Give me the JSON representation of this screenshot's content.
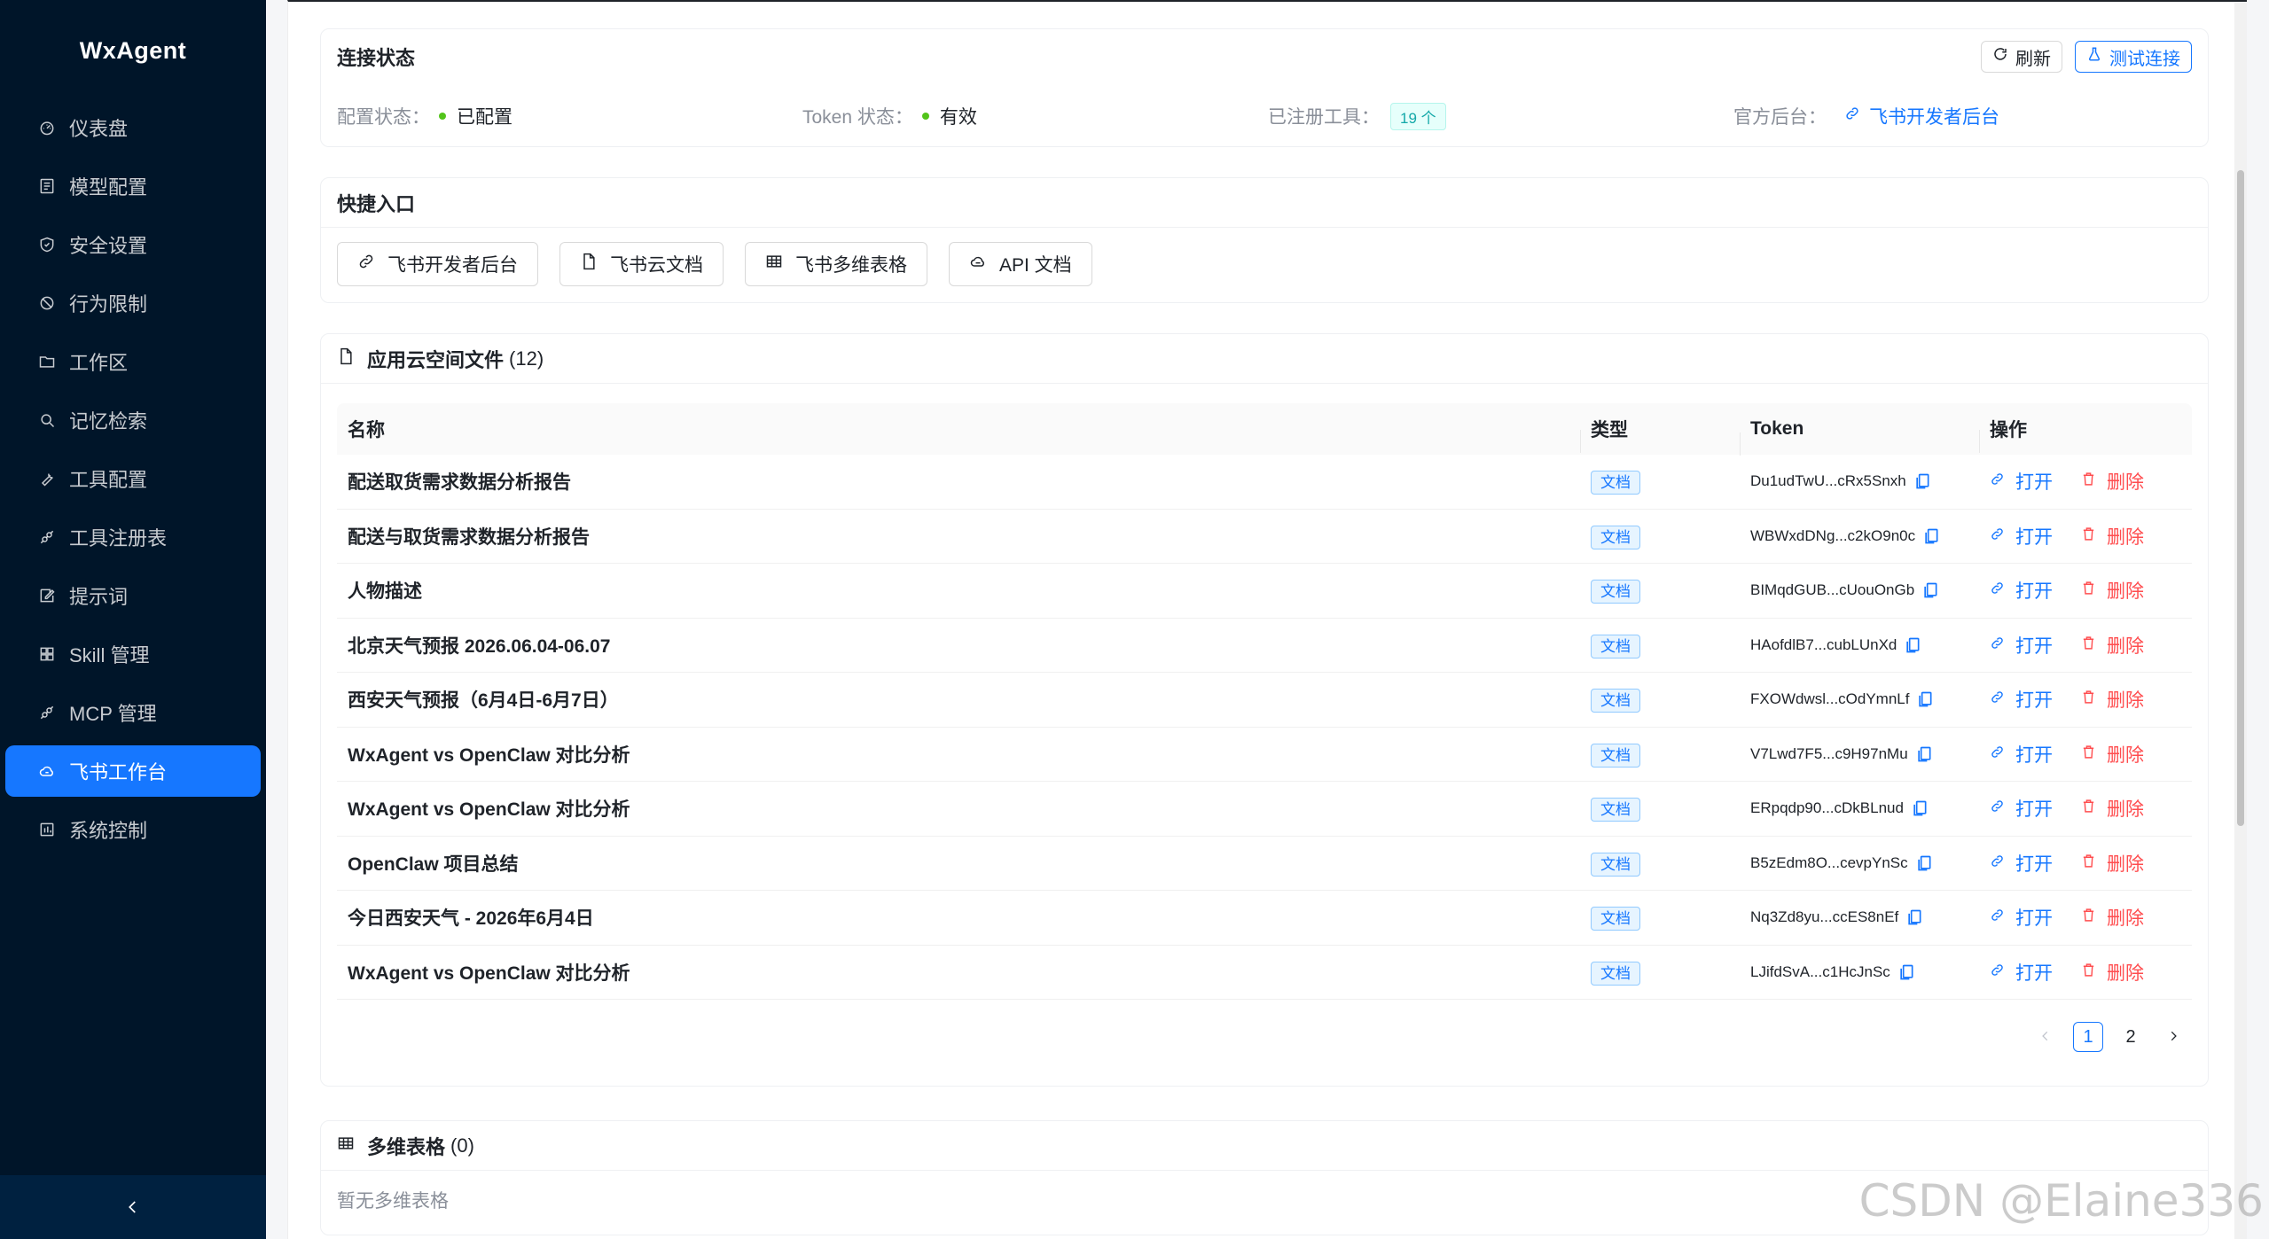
{
  "app": {
    "title": "WxAgent"
  },
  "sidebar": {
    "items": [
      {
        "label": "仪表盘",
        "icon": "dashboard-icon"
      },
      {
        "label": "模型配置",
        "icon": "model-icon"
      },
      {
        "label": "安全设置",
        "icon": "shield-icon"
      },
      {
        "label": "行为限制",
        "icon": "ban-icon"
      },
      {
        "label": "工作区",
        "icon": "folder-icon"
      },
      {
        "label": "记忆检索",
        "icon": "search-icon"
      },
      {
        "label": "工具配置",
        "icon": "wrench-icon"
      },
      {
        "label": "工具注册表",
        "icon": "api-icon"
      },
      {
        "label": "提示词",
        "icon": "edit-icon"
      },
      {
        "label": "Skill 管理",
        "icon": "grid-icon"
      },
      {
        "label": "MCP 管理",
        "icon": "api-icon"
      },
      {
        "label": "飞书工作台",
        "icon": "cloud-icon",
        "active": true
      },
      {
        "label": "系统控制",
        "icon": "control-icon"
      }
    ]
  },
  "connection": {
    "title": "连接状态",
    "refresh_label": "刷新",
    "test_label": "测试连接",
    "config_label": "配置状态：",
    "config_value": "已配置",
    "token_label": "Token 状态：",
    "token_value": "有效",
    "tools_label": "已注册工具：",
    "tools_value": "19 个",
    "console_label": "官方后台：",
    "console_link": "飞书开发者后台"
  },
  "quick": {
    "title": "快捷入口",
    "buttons": [
      {
        "label": "飞书开发者后台",
        "icon": "link-icon"
      },
      {
        "label": "飞书云文档",
        "icon": "file-icon"
      },
      {
        "label": "飞书多维表格",
        "icon": "table-icon"
      },
      {
        "label": "API 文档",
        "icon": "api-cloud-icon"
      }
    ]
  },
  "files": {
    "title": "应用云空间文件",
    "count": "(12)",
    "columns": {
      "name": "名称",
      "type": "类型",
      "token": "Token",
      "op": "操作"
    },
    "open_label": "打开",
    "delete_label": "删除",
    "rows": [
      {
        "name": "配送取货需求数据分析报告",
        "type": "文档",
        "token": "Du1udTwU...cRx5Snxh"
      },
      {
        "name": "配送与取货需求数据分析报告",
        "type": "文档",
        "token": "WBWxdDNg...c2kO9n0c"
      },
      {
        "name": "人物描述",
        "type": "文档",
        "token": "BIMqdGUB...cUouOnGb"
      },
      {
        "name": "北京天气预报 2026.06.04-06.07",
        "type": "文档",
        "token": "HAofdlB7...cubLUnXd"
      },
      {
        "name": "西安天气预报（6月4日-6月7日）",
        "type": "文档",
        "token": "FXOWdwsl...cOdYmnLf"
      },
      {
        "name": "WxAgent vs OpenClaw 对比分析",
        "type": "文档",
        "token": "V7Lwd7F5...c9H97nMu"
      },
      {
        "name": "WxAgent vs OpenClaw 对比分析",
        "type": "文档",
        "token": "ERpqdp90...cDkBLnud"
      },
      {
        "name": "OpenClaw 项目总结",
        "type": "文档",
        "token": "B5zEdm8O...cevpYnSc"
      },
      {
        "name": "今日西安天气 - 2026年6月4日",
        "type": "文档",
        "token": "Nq3Zd8yu...ccES8nEf"
      },
      {
        "name": "WxAgent vs OpenClaw 对比分析",
        "type": "文档",
        "token": "LJifdSvA...c1HcJnSc"
      }
    ],
    "pagination": {
      "pages": [
        "1",
        "2"
      ],
      "current": "1"
    }
  },
  "bitable": {
    "title": "多维表格",
    "count": "(0)",
    "empty": "暂无多维表格"
  },
  "watermark": "CSDN @Elaine336",
  "colors": {
    "sidebar_bg": "#001529",
    "accent": "#1677ff",
    "danger": "#ff4d4f",
    "success": "#52c41a"
  }
}
